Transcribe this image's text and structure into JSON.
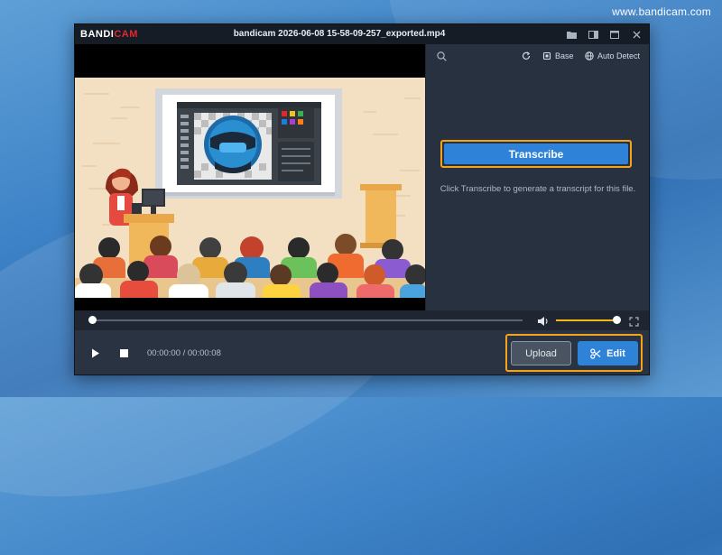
{
  "watermark": "www.bandicam.com",
  "window": {
    "logo_white": "BANDI",
    "logo_red": "CAM",
    "title": "bandicam 2026-06-08 15-58-09-257_exported.mp4",
    "controls": [
      "folder-icon",
      "layout-icon",
      "maximize-icon",
      "close-icon"
    ]
  },
  "right_panel": {
    "toolbar": {
      "search_icon": "search-icon",
      "refresh_icon": "refresh-icon",
      "model_label": "Base",
      "language_label": "Auto Detect"
    },
    "transcribe_label": "Transcribe",
    "hint": "Click Transcribe to generate a transcript for this file."
  },
  "player": {
    "progress": 0,
    "volume": 0.95,
    "time": "00:00:00 / 00:00:08"
  },
  "actions": {
    "upload_label": "Upload",
    "edit_label": "Edit"
  },
  "colors": {
    "accent": "#2e82d8",
    "highlight": "#f5a31b",
    "volume": "#f5b819",
    "brand_red": "#e2262d"
  }
}
